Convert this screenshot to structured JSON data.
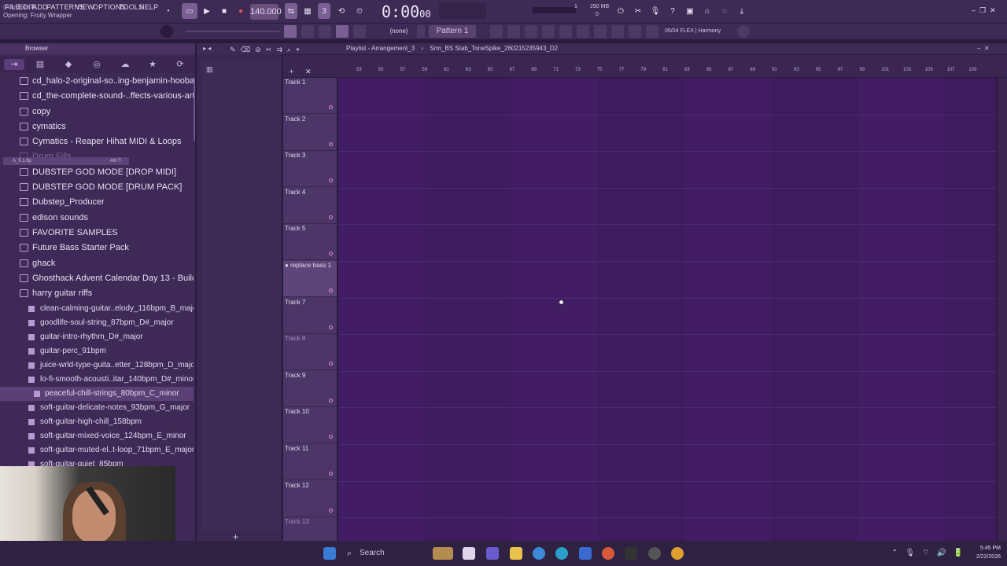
{
  "window": {
    "user": "(JohnJudson)",
    "opening": "Opening: Fruity Wrapper",
    "tempo": "140.000",
    "time": "0:00",
    "time_frac": "00",
    "time_label": "M:S:CS",
    "memory": "290 MB",
    "cpu_small": "0",
    "voices": "1"
  },
  "menu": [
    "FILE",
    "EDIT",
    "ADD",
    "PATTERNS",
    "VIEW",
    "OPTIONS",
    "TOOLS",
    "HELP"
  ],
  "toolbar": {
    "none_select": "(none)",
    "pattern": "Pattern 1",
    "preset": "05/04  FLEX | Harmony"
  },
  "browser": {
    "title": "Browser",
    "folders": [
      "cd_halo-2-original-so..ing-benjamin-hoobasta",
      "cd_the-complete-sound-..ffects-various-artists",
      "copy",
      "cymatics",
      "Cymatics - Reaper Hihat MIDI & Loops",
      "Drum Fills",
      "DUBSTEP GOD MODE [DROP MIDI]",
      "DUBSTEP GOD MODE [DRUM PACK]",
      "Dubstep_Producer",
      "edison sounds",
      "FAVORITE SAMPLES",
      "Future Bass Starter Pack",
      "ghack",
      "Ghosthack Advent Calendar Day 13 - Buildups",
      "harry guitar riffs"
    ],
    "files": [
      "clean-calming-guitar..elody_116bpm_B_major",
      "goodlife-soul-string_87bpm_D#_major",
      "guitar-intro-rhythm_D#_major",
      "guitar-perc_91bpm",
      "juice-wrld-type-guita..etter_128bpm_D_major",
      "lo-fi-smooth-acousti..itar_140bpm_D#_minor",
      "peaceful-chill-strings_80bpm_C_minor",
      "soft-guitar-delicate-notes_93bpm_G_major",
      "soft-guitar-high-chill_158bpm",
      "soft-guitar-mixed-voice_124bpm_E_minor",
      "soft-guitar-muted-el..t-loop_71bpm_E_major",
      "soft-guitar-quiet_85bpm"
    ],
    "selected_file": "peaceful-chill-strings_80bpm_C_minor",
    "drag_tip": "A_5.1.flp",
    "drag_key": "Alt+T"
  },
  "playlist": {
    "title": "Playlist - Arrangement_3",
    "sample": "Srm_BS Stab_ToneSpike_260215235943_D2",
    "ruler": [
      "53",
      "55",
      "57",
      "59",
      "61",
      "63",
      "65",
      "67",
      "69",
      "71",
      "73",
      "75",
      "77",
      "79",
      "81",
      "83",
      "85",
      "87",
      "89",
      "91",
      "93",
      "95",
      "97",
      "99",
      "101",
      "103",
      "105",
      "107",
      "109"
    ],
    "tracks": [
      {
        "name": "Track 1",
        "state": "normal"
      },
      {
        "name": "Track 2",
        "state": "normal"
      },
      {
        "name": "Track 3",
        "state": "normal"
      },
      {
        "name": "Track 4",
        "state": "normal"
      },
      {
        "name": "Track 5",
        "state": "normal"
      },
      {
        "name": "replace bass 1",
        "state": "highlight"
      },
      {
        "name": "Track 7",
        "state": "normal"
      },
      {
        "name": "Track 8",
        "state": "dim"
      },
      {
        "name": "Track 9",
        "state": "normal"
      },
      {
        "name": "Track 10",
        "state": "normal"
      },
      {
        "name": "Track 11",
        "state": "normal"
      },
      {
        "name": "Track 12",
        "state": "normal"
      },
      {
        "name": "Track 13",
        "state": "dim"
      }
    ]
  },
  "taskbar": {
    "search": "Search",
    "time": "5:45 PM",
    "date": "2/22/2026"
  },
  "colors": {
    "accent": "#d98bd9",
    "grid_a": "#431d64",
    "grid_b": "#3e1a5e",
    "record": "#e05050"
  }
}
